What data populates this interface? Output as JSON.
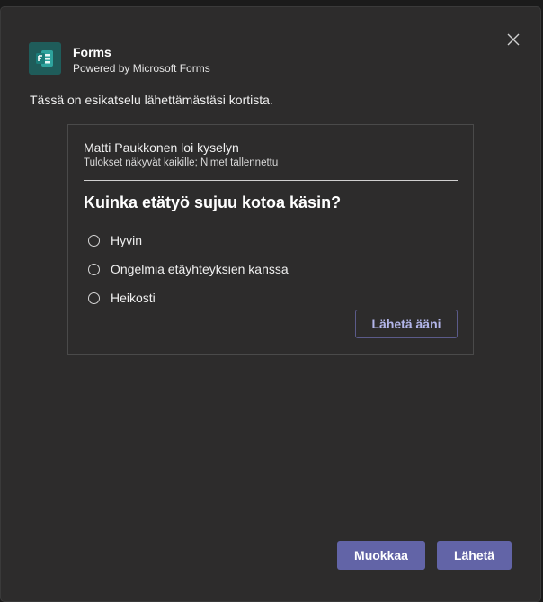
{
  "app": {
    "title": "Forms",
    "subtitle": "Powered by Microsoft Forms",
    "icon": "microsoft-forms-icon",
    "icon_color": "#1f5c5a"
  },
  "intro_text": "Tässä on esikatselu lähettämästäsi kortista.",
  "card": {
    "creator_line": "Matti Paukkonen loi kyselyn",
    "meta_line": "Tulokset näkyvät kaikille; Nimet tallennettu",
    "question": "Kuinka etätyö sujuu kotoa käsin?",
    "options": [
      "Hyvin",
      "Ongelmia etäyhteyksien kanssa",
      "Heikosti"
    ],
    "submit_label": "Lähetä ääni"
  },
  "footer": {
    "edit_label": "Muokkaa",
    "send_label": "Lähetä"
  },
  "colors": {
    "dialog_bg": "#2d2c2c",
    "accent": "#6264a7",
    "accent_text": "#b3b6ea"
  }
}
